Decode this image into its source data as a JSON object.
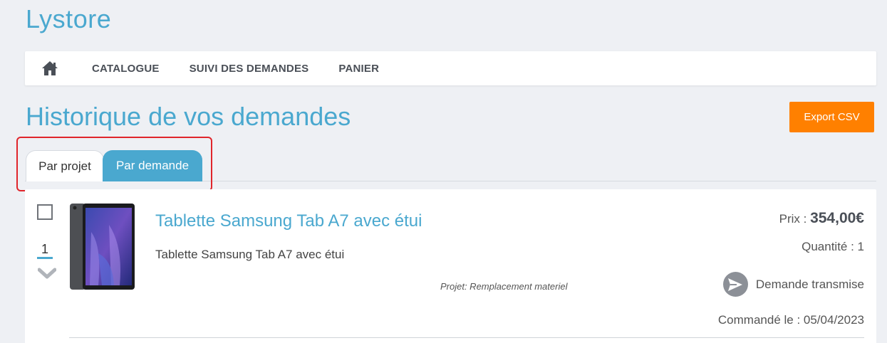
{
  "app": {
    "title": "Lystore"
  },
  "navbar": {
    "home_icon": "home-icon",
    "items": [
      {
        "label": "CATALOGUE"
      },
      {
        "label": "SUIVI DES DEMANDES"
      },
      {
        "label": "PANIER"
      }
    ]
  },
  "page": {
    "title": "Historique de vos demandes",
    "export_label": "Export CSV",
    "export_color": "#ff8000",
    "accent_color": "#4aa8cf"
  },
  "tabs": [
    {
      "label": "Par projet",
      "active": false
    },
    {
      "label": "Par demande",
      "active": true
    }
  ],
  "request": {
    "selected": false,
    "priority": "1",
    "product_title": "Tablette Samsung Tab A7 avec étui",
    "product_description": "Tablette Samsung Tab A7 avec étui",
    "projet": "Projet: Remplacement materiel",
    "price_label": "Prix : ",
    "price_value": "354,00€",
    "quantity": "Quantité : 1",
    "status": "Demande transmise",
    "ordered": "Commandé le : 05/04/2023"
  }
}
